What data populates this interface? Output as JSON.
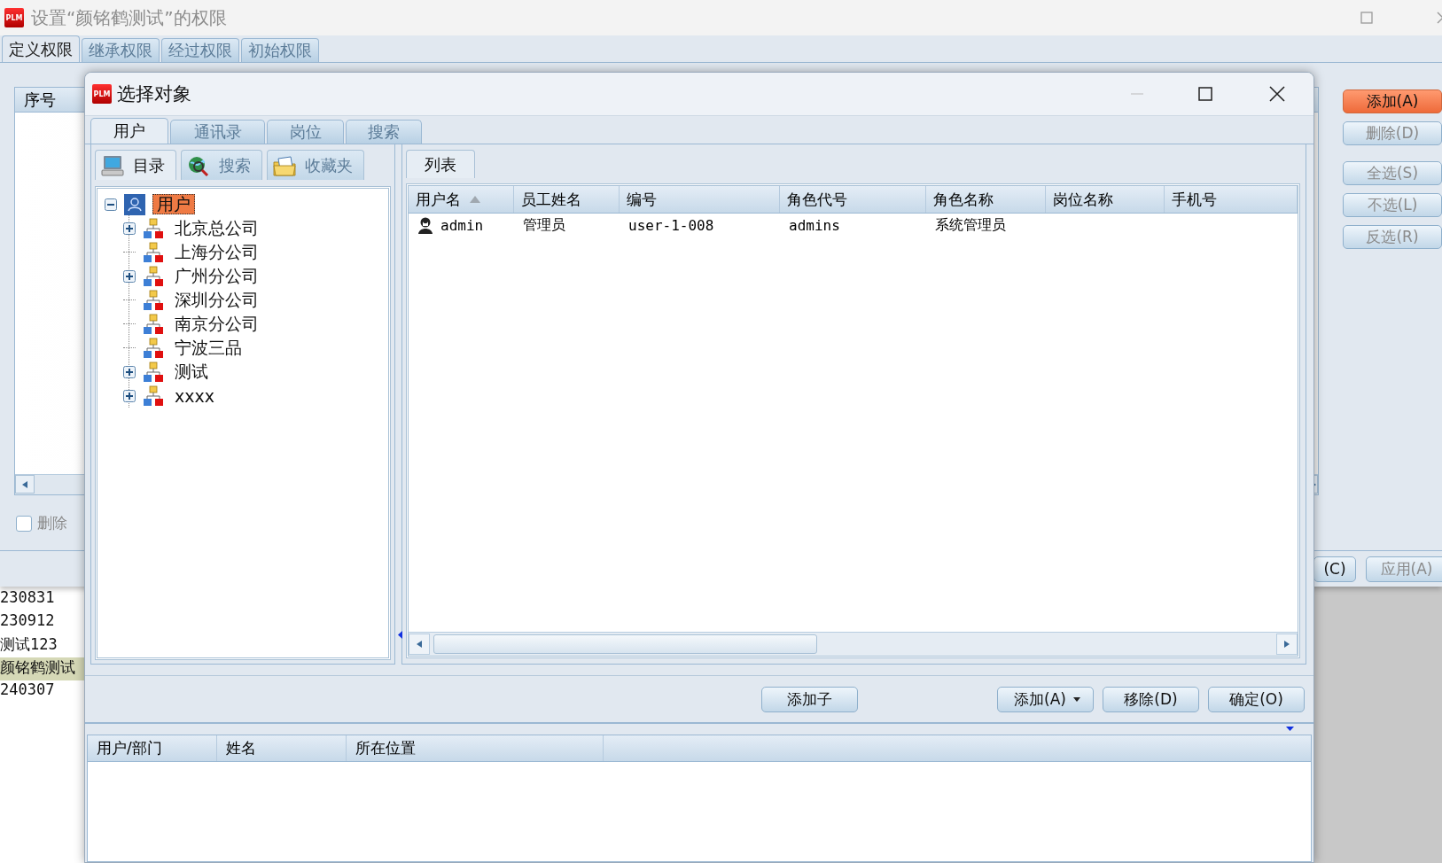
{
  "back_list": {
    "rows": [
      {
        "text": "230831",
        "selected": false
      },
      {
        "text": "230912",
        "selected": false
      },
      {
        "text": "测试123",
        "selected": false
      },
      {
        "text": "颜铭鹤测试",
        "selected": true
      },
      {
        "text": "240307",
        "selected": false
      }
    ]
  },
  "main_window": {
    "app_icon_text": "PLM",
    "title": "设置“颜铭鹤测试”的权限",
    "tabs": [
      {
        "label": "定义权限",
        "selected": true
      },
      {
        "label": "继承权限",
        "selected": false
      },
      {
        "label": "经过权限",
        "selected": false
      },
      {
        "label": "初始权限",
        "selected": false
      }
    ],
    "table": {
      "columns": [
        "序号"
      ]
    },
    "delete_checkbox": {
      "label": "删除",
      "checked": false
    },
    "side_button_groups": [
      {
        "buttons": [
          {
            "label": "添加(A)",
            "highlighted": true,
            "disabled": false
          },
          {
            "label": "删除(D)",
            "highlighted": false,
            "disabled": true
          }
        ]
      },
      {
        "buttons": [
          {
            "label": "全选(S)",
            "highlighted": false,
            "disabled": true
          },
          {
            "label": "不选(L)",
            "highlighted": false,
            "disabled": true
          },
          {
            "label": "反选(R)",
            "highlighted": false,
            "disabled": true
          }
        ]
      }
    ],
    "footer_buttons": [
      {
        "label": "(C)",
        "disabled": false
      },
      {
        "label": "应用(A)",
        "disabled": true
      }
    ]
  },
  "dialog": {
    "app_icon_text": "PLM",
    "title": "选择对象",
    "tabs": [
      {
        "label": "用户",
        "selected": true
      },
      {
        "label": "通讯录",
        "selected": false
      },
      {
        "label": "岗位",
        "selected": false
      },
      {
        "label": "搜索",
        "selected": false
      }
    ],
    "subtabs": [
      {
        "label": "目录",
        "kind": "directory",
        "selected": true
      },
      {
        "label": "搜索",
        "kind": "search",
        "selected": false
      },
      {
        "label": "收藏夹",
        "kind": "favorites",
        "selected": false
      }
    ],
    "tree": {
      "label": "用户",
      "kind": "root",
      "expanded": true,
      "selected": true,
      "children": [
        {
          "label": "北京总公司",
          "kind": "branch",
          "expanded": false,
          "selected": false
        },
        {
          "label": "上海分公司",
          "kind": "leaf",
          "selected": false
        },
        {
          "label": "广州分公司",
          "kind": "branch",
          "expanded": false,
          "selected": false
        },
        {
          "label": "深圳分公司",
          "kind": "leaf",
          "selected": false
        },
        {
          "label": "南京分公司",
          "kind": "leaf",
          "selected": false
        },
        {
          "label": "宁波三品",
          "kind": "leaf",
          "selected": false
        },
        {
          "label": "测试",
          "kind": "branch",
          "expanded": false,
          "selected": false
        },
        {
          "label": "xxxx",
          "kind": "branch",
          "expanded": false,
          "selected": false
        }
      ]
    },
    "list_tabs": [
      {
        "label": "列表",
        "selected": true
      }
    ],
    "table": {
      "columns": [
        {
          "label": "用户名",
          "sorted": true
        },
        {
          "label": "员工姓名",
          "sorted": false
        },
        {
          "label": "编号",
          "sorted": false
        },
        {
          "label": "角色代号",
          "sorted": false
        },
        {
          "label": "角色名称",
          "sorted": false
        },
        {
          "label": "岗位名称",
          "sorted": false
        },
        {
          "label": "手机号",
          "sorted": false
        }
      ],
      "rows": [
        {
          "cells": [
            "admin",
            "管理员",
            "user-1-008",
            "admins",
            "系统管理员"
          ]
        }
      ]
    },
    "buttons": [
      {
        "label": "添加子",
        "kind": "plain"
      },
      {
        "label": "添加(A)",
        "kind": "dropdown"
      },
      {
        "label": "移除(D)",
        "kind": "plain"
      },
      {
        "label": "确定(O)",
        "kind": "plain"
      }
    ],
    "selection_table": {
      "columns": [
        "用户/部门",
        "姓名",
        "所在位置"
      ]
    }
  }
}
